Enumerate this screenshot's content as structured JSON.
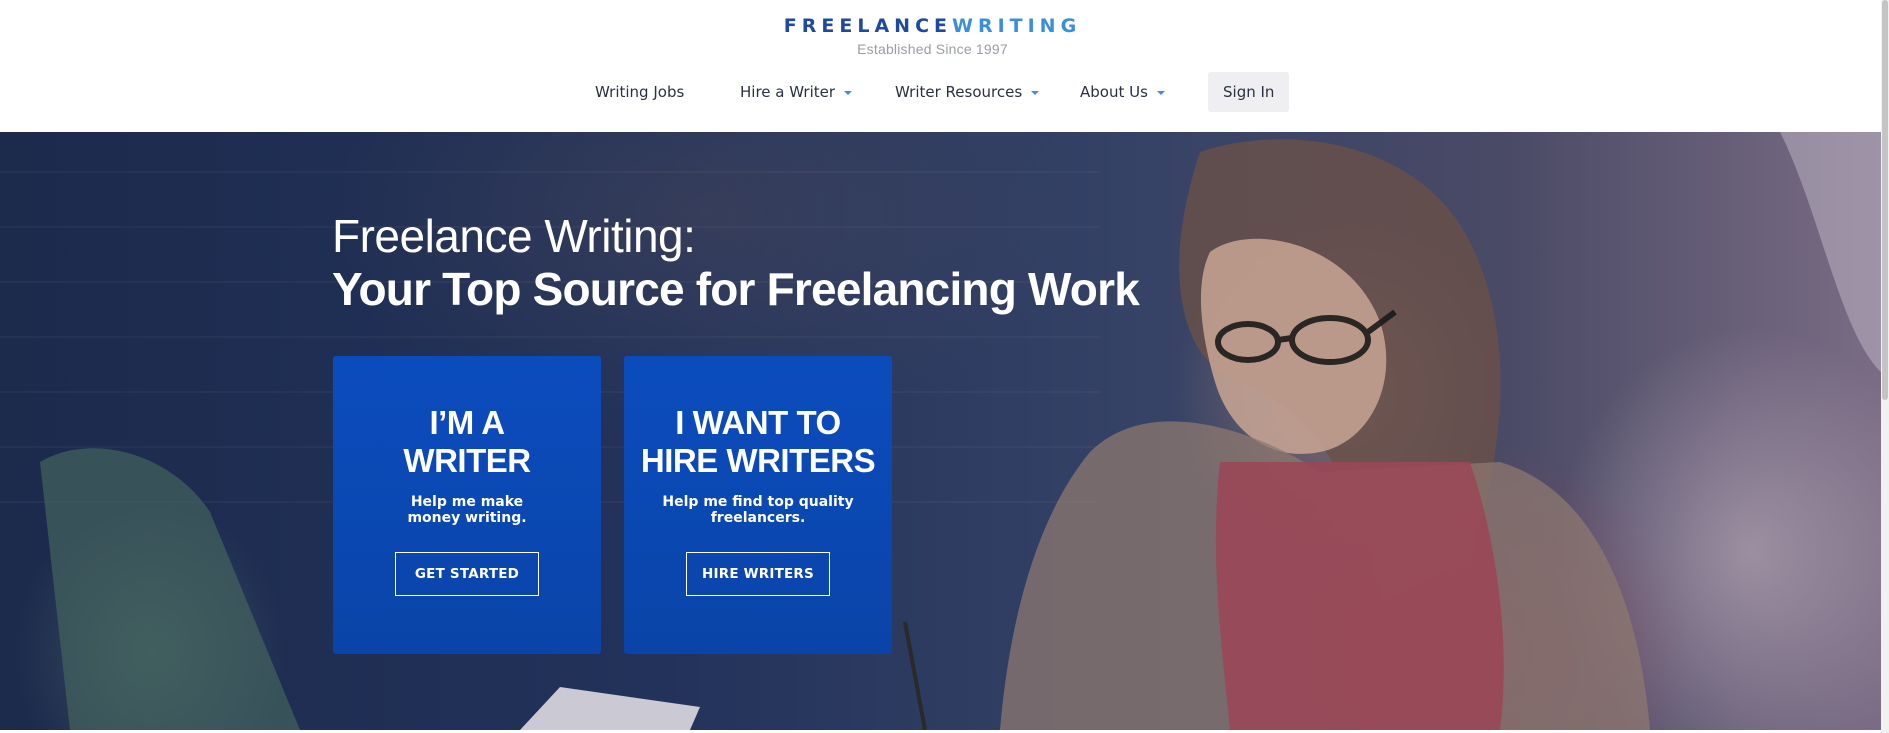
{
  "brand": {
    "name_part1": "FREELANCE",
    "name_part2": "WRITING",
    "tagline": "Established Since 1997",
    "color_dark": "#1d4a9e",
    "color_light": "#3a8ede"
  },
  "nav": {
    "items": [
      {
        "label": "Writing Jobs",
        "has_dropdown": false
      },
      {
        "label": "Hire a Writer",
        "has_dropdown": true
      },
      {
        "label": "Writer Resources",
        "has_dropdown": true
      },
      {
        "label": "About Us",
        "has_dropdown": true
      }
    ],
    "signin_label": "Sign In"
  },
  "hero": {
    "line1": "Freelance Writing:",
    "line2": "Your Top Source for Freelancing Work",
    "cards": [
      {
        "title_line1": "I’M A",
        "title_line2": "WRITER",
        "subtitle_line1": "Help me make",
        "subtitle_line2": "money writing.",
        "button": "GET STARTED"
      },
      {
        "title_line1": "I WANT TO",
        "title_line2": "HIRE WRITERS",
        "subtitle_line1": "Help me find top quality",
        "subtitle_line2": "freelancers.",
        "button": "HIRE WRITERS"
      }
    ],
    "card_color": "#0b4cbd"
  }
}
